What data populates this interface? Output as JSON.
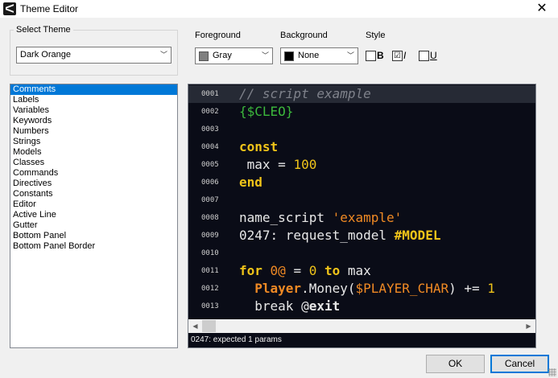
{
  "window": {
    "title": "Theme Editor",
    "close_glyph": "✕"
  },
  "select_theme": {
    "label": "Select Theme",
    "value": "Dark Orange"
  },
  "foreground": {
    "label": "Foreground",
    "value": "Gray",
    "swatch_color": "#808080"
  },
  "background": {
    "label": "Background",
    "value": "None",
    "swatch_color": "#000000"
  },
  "style": {
    "label": "Style",
    "bold": {
      "label": "B",
      "checked": false,
      "mark": ""
    },
    "italic": {
      "label": "I",
      "checked": true,
      "mark": "☑"
    },
    "underline": {
      "label": "U",
      "checked": false,
      "mark": ""
    }
  },
  "elements_list": [
    "Comments",
    "Labels",
    "Variables",
    "Keywords",
    "Numbers",
    "Strings",
    "Models",
    "Classes",
    "Commands",
    "Directives",
    "Constants",
    "Editor",
    "Active Line",
    "Gutter",
    "Bottom Panel",
    "Bottom Panel Border"
  ],
  "selected_element": "Comments",
  "code_lines": [
    {
      "num": "0001",
      "active": true,
      "tokens": [
        [
          "comment",
          "// script example"
        ]
      ]
    },
    {
      "num": "0002",
      "tokens": [
        [
          "directive",
          "{$CLEO}"
        ]
      ]
    },
    {
      "num": "0003",
      "tokens": []
    },
    {
      "num": "0004",
      "tokens": [
        [
          "keyword",
          "const"
        ]
      ]
    },
    {
      "num": "0005",
      "tokens": [
        [
          "plain",
          " max = "
        ],
        [
          "number",
          "100"
        ]
      ]
    },
    {
      "num": "0006",
      "tokens": [
        [
          "keyword",
          "end"
        ]
      ]
    },
    {
      "num": "0007",
      "tokens": []
    },
    {
      "num": "0008",
      "tokens": [
        [
          "plain",
          "name_script "
        ],
        [
          "string",
          "'example'"
        ]
      ]
    },
    {
      "num": "0009",
      "tokens": [
        [
          "plain",
          "0247: request_model "
        ],
        [
          "model",
          "#MODEL"
        ]
      ]
    },
    {
      "num": "0010",
      "tokens": []
    },
    {
      "num": "0011",
      "tokens": [
        [
          "keyword",
          "for"
        ],
        [
          "plain",
          " "
        ],
        [
          "var",
          "0@"
        ],
        [
          "plain",
          " = "
        ],
        [
          "number",
          "0"
        ],
        [
          "plain",
          " "
        ],
        [
          "keyword",
          "to"
        ],
        [
          "plain",
          " max"
        ]
      ]
    },
    {
      "num": "0012",
      "tokens": [
        [
          "plain",
          "  "
        ],
        [
          "class",
          "Player"
        ],
        [
          "plain",
          ".Money("
        ],
        [
          "var",
          "$PLAYER_CHAR"
        ],
        [
          "plain",
          ") += "
        ],
        [
          "number",
          "1"
        ]
      ]
    },
    {
      "num": "0013",
      "tokens": [
        [
          "plain",
          "  break @"
        ],
        [
          "label",
          "exit"
        ]
      ]
    }
  ],
  "status": {
    "text": "0247: expected 1 params"
  },
  "scrollbar": {
    "left_arrow": "◀",
    "right_arrow": "▶"
  },
  "buttons": {
    "ok": "OK",
    "cancel": "Cancel"
  },
  "colors": {
    "editor_bg": "#0a0c17",
    "active_line": "#262a35",
    "selection": "#0078d7",
    "accent": "#f0c419"
  }
}
